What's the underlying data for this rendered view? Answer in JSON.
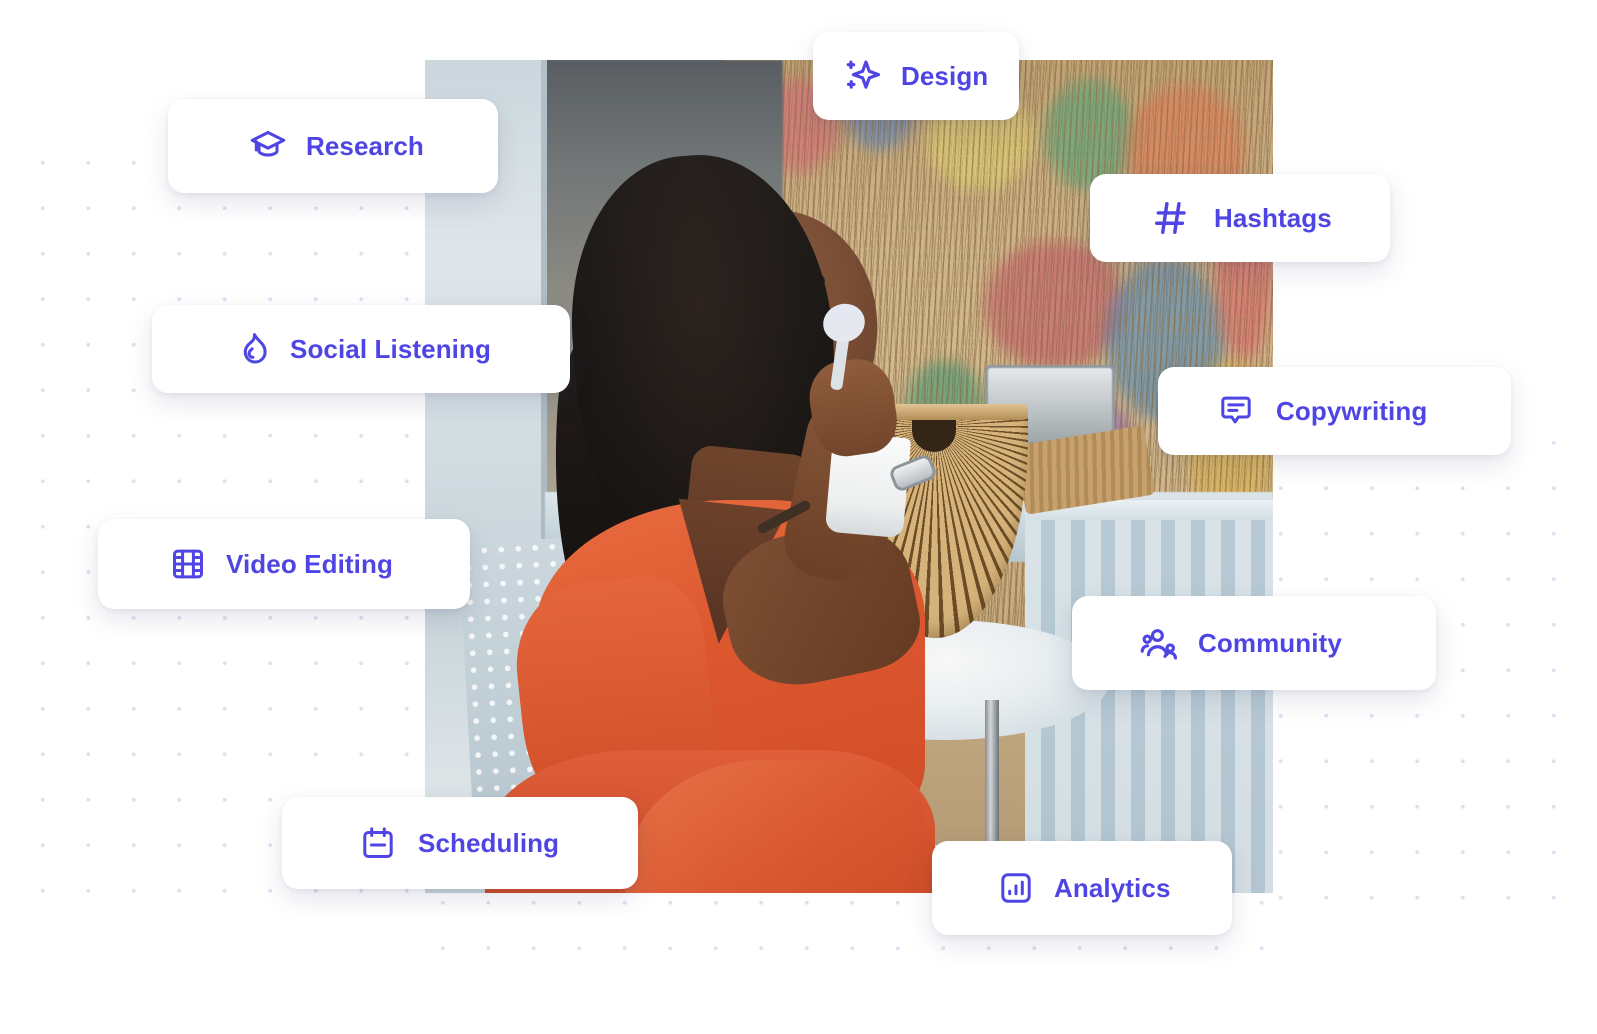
{
  "hero": {
    "photo_alt": "Smiling woman in orange jumpsuit eating yogurt at a cafe table",
    "accent_color": "#4F45E4",
    "card_background": "#FFFFFF",
    "page_background": "#FFFFFF",
    "dot_color": "#D8DAF0"
  },
  "cards": [
    {
      "id": "research",
      "label": "Research",
      "icon": "graduation-cap-icon"
    },
    {
      "id": "design",
      "label": "Design",
      "icon": "sparkle-icon"
    },
    {
      "id": "hashtags",
      "label": "Hashtags",
      "icon": "hashtag-icon"
    },
    {
      "id": "social",
      "label": "Social Listening",
      "icon": "flame-icon"
    },
    {
      "id": "copywriting",
      "label": "Copywriting",
      "icon": "chat-bubble-icon"
    },
    {
      "id": "video",
      "label": "Video Editing",
      "icon": "film-strip-icon"
    },
    {
      "id": "community",
      "label": "Community",
      "icon": "people-group-icon"
    },
    {
      "id": "scheduling",
      "label": "Scheduling",
      "icon": "calendar-icon"
    },
    {
      "id": "analytics",
      "label": "Analytics",
      "icon": "bar-chart-icon"
    }
  ]
}
